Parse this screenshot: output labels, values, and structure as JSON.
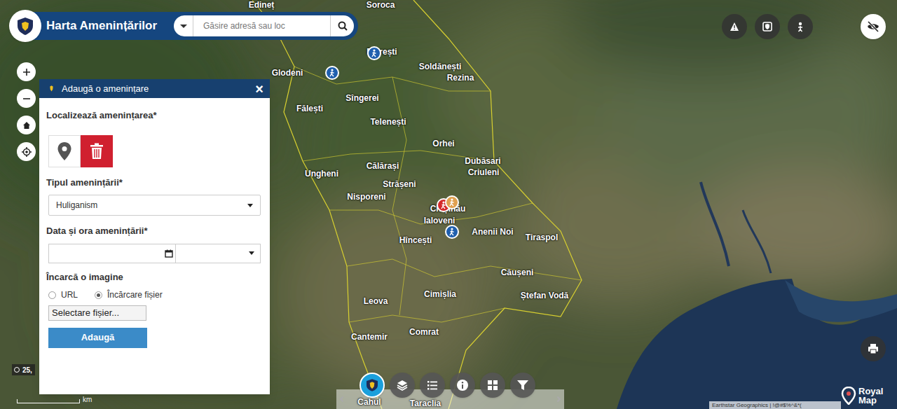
{
  "header": {
    "title": "Harta Amenințărilor",
    "search": {
      "placeholder": "Găsire adresă sau loc"
    }
  },
  "map": {
    "labels": [
      "Edineț",
      "Soroca",
      "Florești",
      "Glodeni",
      "Soldănești",
      "Rezina",
      "Sîngerei",
      "Fălești",
      "Telenești",
      "Orhei",
      "Dubăsari",
      "Criuleni",
      "Ungheni",
      "Călărași",
      "Strășeni",
      "Nisporeni",
      "Chișinău",
      "Ialoveni",
      "Anenii Noi",
      "Tiraspol",
      "Hîncești",
      "Căușeni",
      "Cimișlia",
      "Ștefan Vodă",
      "Leova",
      "Comrat",
      "Cantemir",
      "Cahul",
      "Taraclia"
    ],
    "markers": [
      {
        "color": "#1f5fae"
      },
      {
        "color": "#1f5fae"
      },
      {
        "color": "#d42a2a"
      },
      {
        "color": "#e0a050"
      },
      {
        "color": "#1f5fae"
      }
    ]
  },
  "dialog": {
    "title": "Adaugă o amenințare",
    "close": "×",
    "locate_label": "Localizează amenințarea*",
    "type_label": "Tipul amenințării*",
    "type_value": "Huliganism",
    "datetime_label": "Data și ora amenințării*",
    "image_label": "Încarcă o imagine",
    "image_sources": [
      {
        "label": "URL",
        "selected": false
      },
      {
        "label": "Încărcare fișier",
        "selected": true
      }
    ],
    "file_button": "Selectare fișier...",
    "submit": "Adaugă"
  },
  "toolbar": {
    "items": [
      {
        "selected": true
      },
      {
        "selected": false
      },
      {
        "selected": false
      },
      {
        "selected": false
      },
      {
        "selected": false
      },
      {
        "selected": false
      }
    ]
  },
  "coordinates": "25,",
  "scale": "km",
  "attribution": "Earthstar Geographics | !@#$%^&*(",
  "brand": "Royal Map"
}
